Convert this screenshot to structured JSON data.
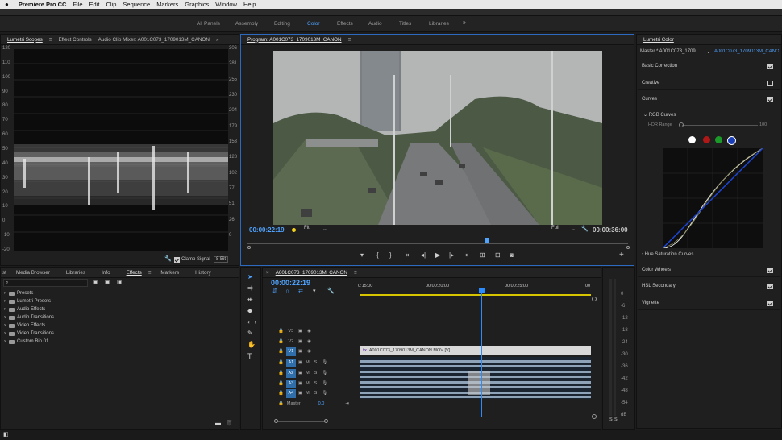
{
  "menubar": {
    "apple": "",
    "app": "Premiere Pro CC",
    "items": [
      "File",
      "Edit",
      "Clip",
      "Sequence",
      "Markers",
      "Graphics",
      "Window",
      "Help"
    ]
  },
  "workspaces": {
    "items": [
      "All Panels",
      "Assembly",
      "Editing",
      "Color",
      "Effects",
      "Audio",
      "Titles",
      "Libraries"
    ],
    "active": "Color"
  },
  "scopes_panel": {
    "tabs": [
      "Lumetri Scopes",
      "Effect Controls",
      "Audio Clip Mixer: A001C073_1709013M_CANON"
    ],
    "left_scale": [
      "120",
      "110",
      "100",
      "90",
      "80",
      "70",
      "60",
      "50",
      "40",
      "30",
      "20",
      "10",
      "0",
      "-10",
      "-20"
    ],
    "right_scale": [
      "306",
      "281",
      "255",
      "230",
      "204",
      "179",
      "153",
      "128",
      "102",
      "77",
      "51",
      "26",
      "0"
    ],
    "clamp_label": "Clamp Signal",
    "bit_label": "8 Bit"
  },
  "program": {
    "title": "Program: A001C073_1709013M_CANON",
    "timecode": "00:00:22:19",
    "fit": "Fit",
    "quality": "Full",
    "duration": "00:00:36:00"
  },
  "lumetri": {
    "title": "Lumetri Color",
    "master": "Master * A001C073_1709...",
    "clip": "A001C073_1709013M_CANON",
    "sections": [
      "Basic Correction",
      "Creative",
      "Curves"
    ],
    "rgb_curves": "RGB Curves",
    "hdr_label": "HDR Range",
    "hdr_value": "100",
    "hsc": "Hue Saturation Curves",
    "more_sections": [
      "Color Wheels",
      "HSL Secondary",
      "Vignette"
    ]
  },
  "project_panel": {
    "tabs": [
      "st",
      "Media Browser",
      "Libraries",
      "Info",
      "Effects",
      "Markers",
      "History"
    ],
    "items": [
      "Presets",
      "Lumetri Presets",
      "Audio Effects",
      "Audio Transitions",
      "Video Effects",
      "Video Transitions",
      "Custom Bin 01"
    ]
  },
  "timeline": {
    "title": "A001C073_1709013M_CANON",
    "timecode": "00:00:22:19",
    "ruler": [
      "0:15:00",
      "00:00:20:00",
      "00:00:25:00",
      "00"
    ],
    "video_tracks": [
      "V3",
      "V2",
      "V1"
    ],
    "audio_tracks": [
      "A1",
      "A2",
      "A3",
      "A4"
    ],
    "master": "Master",
    "master_val": "0.0",
    "clip_name": "A001C073_1709013M_CANON.MOV [V]",
    "fx": "fx"
  },
  "meter": {
    "scale": [
      "0",
      "-6",
      "-12",
      "-18",
      "-24",
      "-30",
      "-36",
      "-42",
      "-48",
      "-54",
      "dB"
    ],
    "solo": [
      "S",
      "S"
    ]
  },
  "colors": {
    "accent": "#4fa3ff",
    "clip": "#d8d8d8",
    "audio": "#8ea2b8",
    "playhead": "#2b8cff"
  }
}
